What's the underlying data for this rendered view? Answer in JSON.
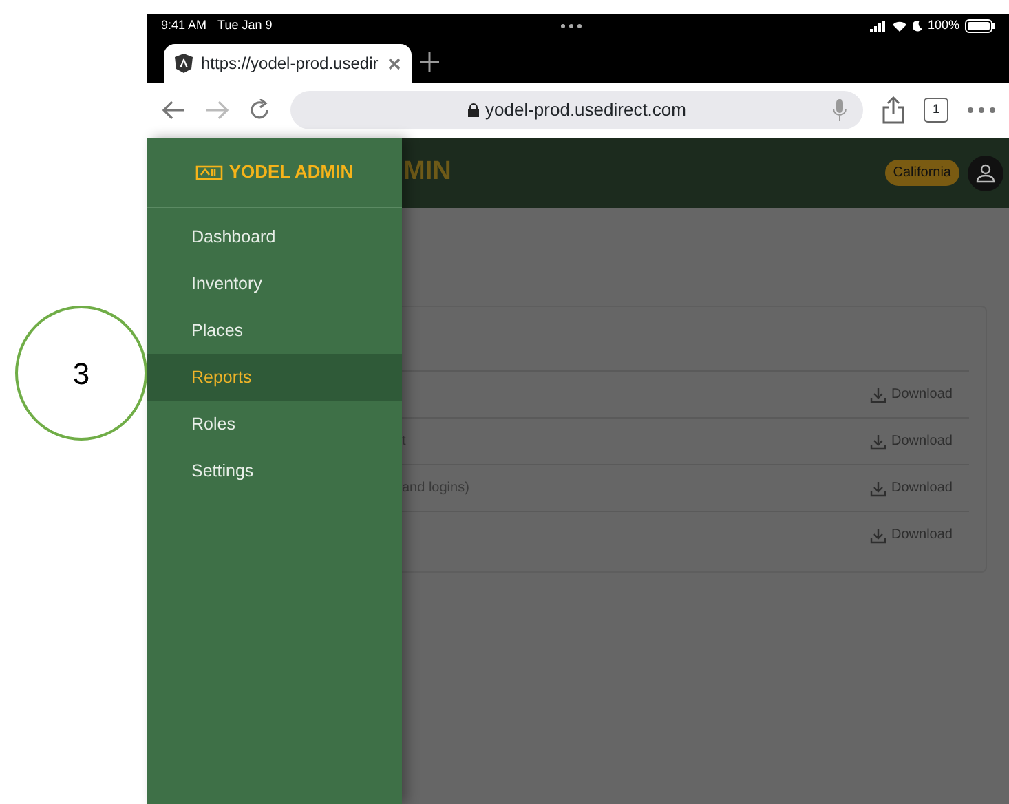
{
  "callout": {
    "label": "3"
  },
  "status_bar": {
    "time": "9:41 AM",
    "date": "Tue Jan 9",
    "battery": "100%"
  },
  "browser_tab": {
    "title": "https://yodel-prod.usedir"
  },
  "address_bar": {
    "url": "yodel-prod.usedirect.com",
    "tab_count": "1"
  },
  "sidebar": {
    "logo": "YODEL ADMIN",
    "items": [
      {
        "label": "Dashboard",
        "selected": false
      },
      {
        "label": "Inventory",
        "selected": false
      },
      {
        "label": "Places",
        "selected": false
      },
      {
        "label": "Reports",
        "selected": true
      },
      {
        "label": "Roles",
        "selected": false
      },
      {
        "label": "Settings",
        "selected": false
      }
    ]
  },
  "header": {
    "title": "MIN",
    "state_badge": "California"
  },
  "reports": [
    {
      "action": "Download"
    },
    {
      "name": "t",
      "action": "Download"
    },
    {
      "name": "and logins)",
      "action": "Download"
    },
    {
      "action": "Download"
    }
  ]
}
